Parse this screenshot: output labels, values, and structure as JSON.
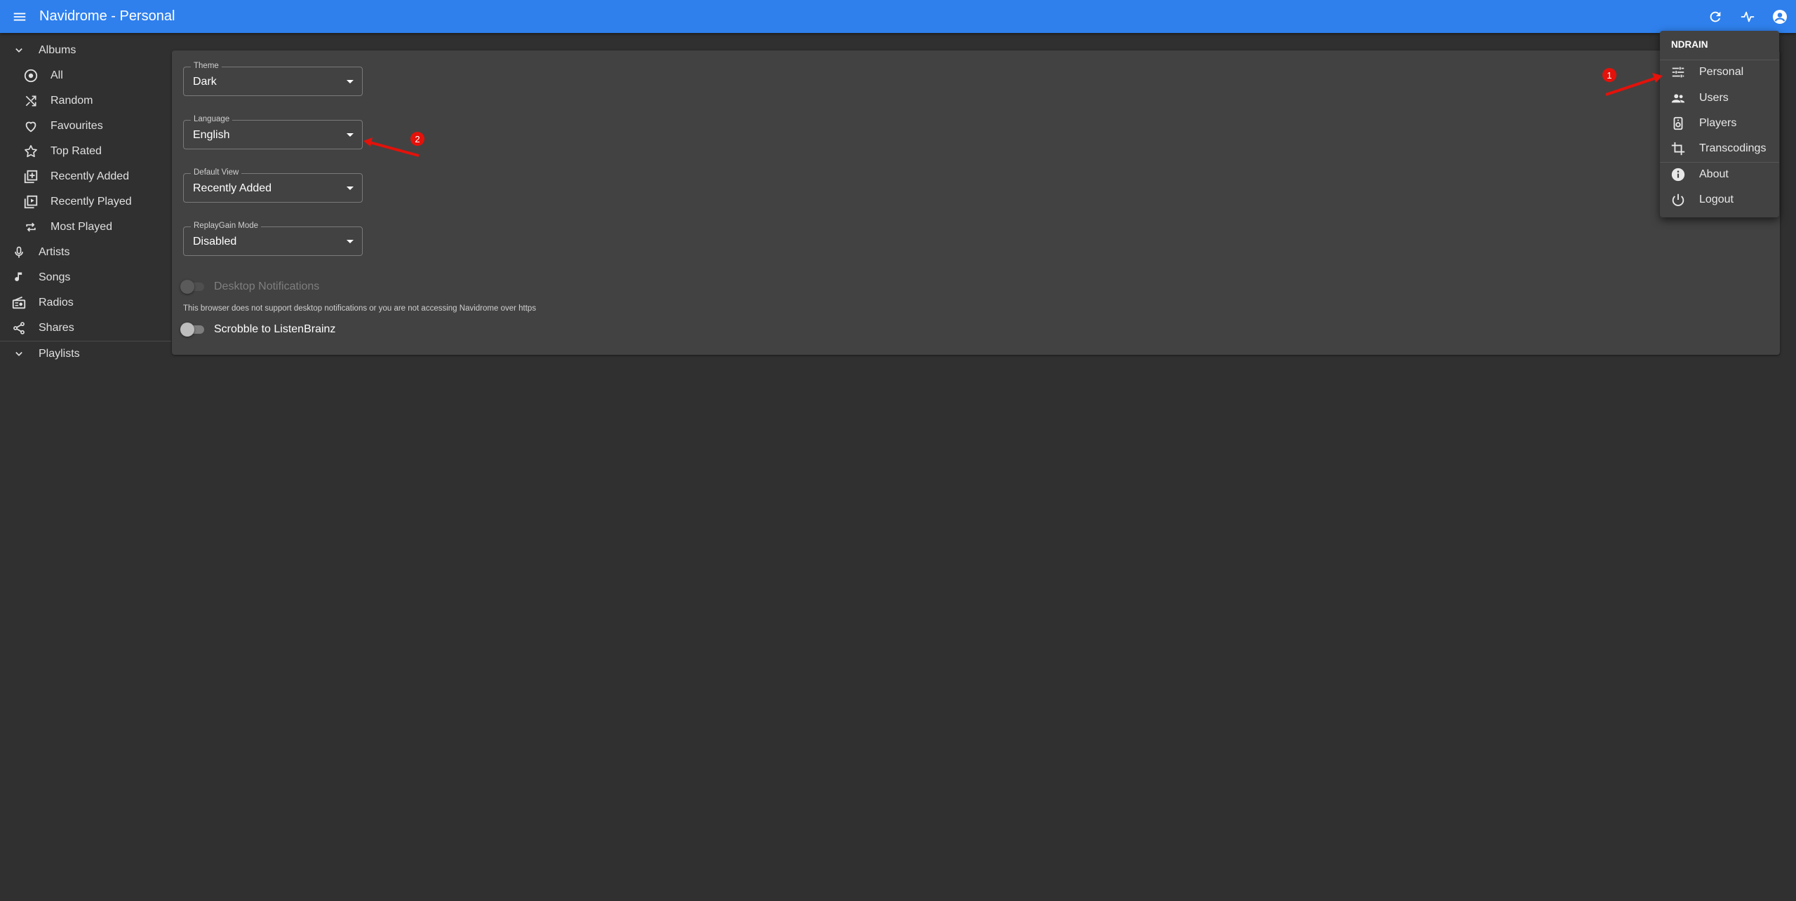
{
  "appbar": {
    "title": "Navidrome - Personal",
    "color": "#2f80ed",
    "icons": [
      "menu-icon",
      "refresh-icon",
      "activity-icon",
      "account-icon"
    ]
  },
  "sidebar": {
    "albums_label": "Albums",
    "album_items": [
      {
        "label": "All",
        "icon": "album-icon"
      },
      {
        "label": "Random",
        "icon": "shuffle-icon"
      },
      {
        "label": "Favourites",
        "icon": "heart-icon"
      },
      {
        "label": "Top Rated",
        "icon": "star-icon"
      },
      {
        "label": "Recently Added",
        "icon": "library-add-icon"
      },
      {
        "label": "Recently Played",
        "icon": "video-library-icon"
      },
      {
        "label": "Most Played",
        "icon": "repeat-icon"
      }
    ],
    "top_items": [
      {
        "label": "Artists",
        "icon": "mic-icon"
      },
      {
        "label": "Songs",
        "icon": "music-note-icon"
      },
      {
        "label": "Radios",
        "icon": "radio-icon"
      },
      {
        "label": "Shares",
        "icon": "share-icon"
      }
    ],
    "playlists_label": "Playlists"
  },
  "settings": {
    "theme": {
      "label": "Theme",
      "value": "Dark"
    },
    "language": {
      "label": "Language",
      "value": "English"
    },
    "default_view": {
      "label": "Default View",
      "value": "Recently Added"
    },
    "replaygain": {
      "label": "ReplayGain Mode",
      "value": "Disabled"
    },
    "desktop_notifications": {
      "label": "Desktop Notifications",
      "enabled": false,
      "disabled": true
    },
    "notifications_hint": "This browser does not support desktop notifications or you are not accessing Navidrome over https",
    "scrobble": {
      "label": "Scrobble to ListenBrainz",
      "enabled": false
    }
  },
  "user_menu": {
    "username": "NDRAIN",
    "items": [
      {
        "label": "Personal",
        "icon": "tune-icon"
      },
      {
        "label": "Users",
        "icon": "people-icon"
      },
      {
        "label": "Players",
        "icon": "speaker-icon"
      },
      {
        "label": "Transcodings",
        "icon": "crop-icon"
      },
      {
        "label": "About",
        "icon": "info-icon"
      },
      {
        "label": "Logout",
        "icon": "power-icon"
      }
    ]
  },
  "annotations": {
    "badge_1": "1",
    "badge_2": "2",
    "color": "#e3120b"
  }
}
